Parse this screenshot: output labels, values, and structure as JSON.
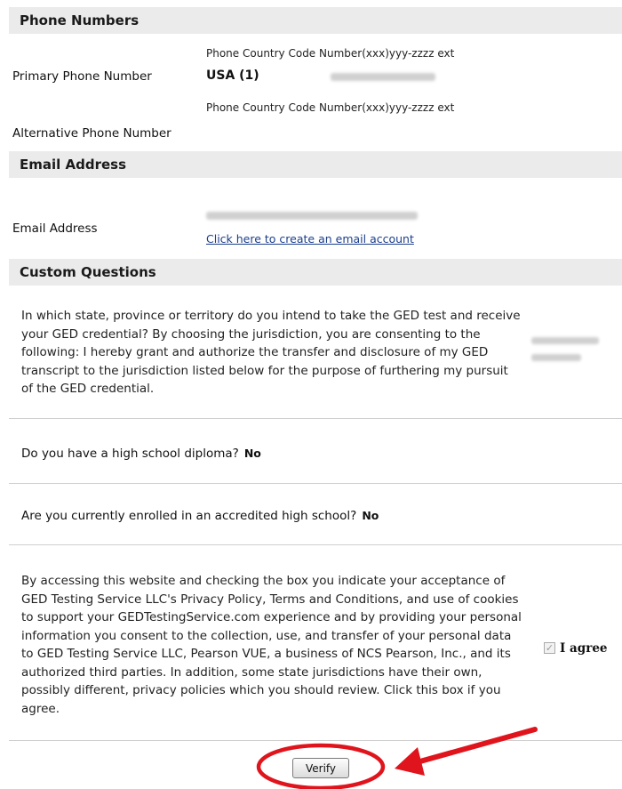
{
  "phone": {
    "header": "Phone Numbers",
    "primary_label": "Primary Phone Number",
    "primary_format_hint": "Phone Country Code Number(xxx)yyy-zzzz ext",
    "primary_country": "USA (1)",
    "alternative_format_hint": "Phone Country Code Number(xxx)yyy-zzzz ext",
    "alternative_label": "Alternative Phone Number"
  },
  "email": {
    "header": "Email Address",
    "label": "Email Address",
    "create_link": "Click here to create an email account"
  },
  "custom": {
    "header": "Custom Questions",
    "jurisdiction_question": "In which state, province or territory do you intend to take the GED test and receive your GED credential? By choosing the jurisdiction, you are consenting to the following: I hereby grant and authorize the transfer and disclosure of my GED transcript to the jurisdiction listed below for the purpose of furthering my pursuit of the GED credential.",
    "diploma_question": "Do you have a high school diploma?",
    "diploma_answer": "No",
    "enrolled_question": "Are you currently enrolled in an accredited high school?",
    "enrolled_answer": "No",
    "privacy_text": "By accessing this website and checking the box you indicate your acceptance of GED Testing Service LLC's Privacy Policy, Terms and Conditions, and use of cookies to support your GEDTestingService.com experience and by providing your personal information you consent to the collection, use, and transfer of your personal data to GED Testing Service LLC, Pearson VUE, a business of NCS Pearson, Inc., and its authorized third parties. In addition, some state jurisdictions have their own, possibly different, privacy policies which you should review. Click this box if you agree.",
    "agree_label": "I agree",
    "agree_checked": true
  },
  "verify_label": "Verify",
  "annotation_color": "#e0141c"
}
